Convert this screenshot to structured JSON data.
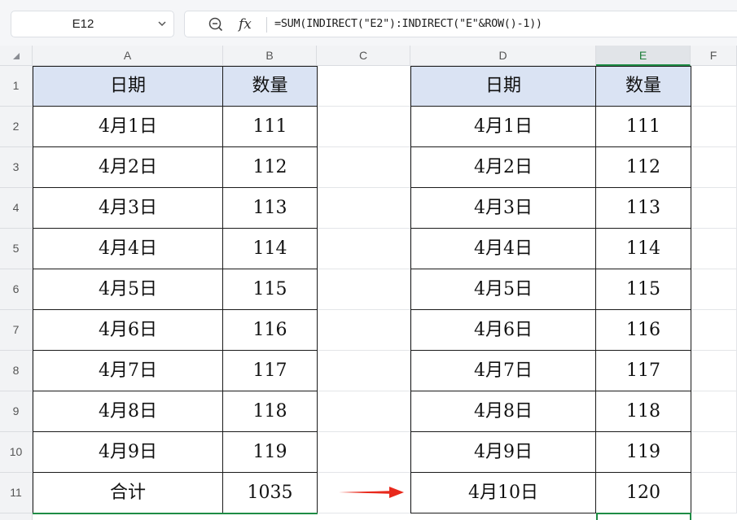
{
  "formula_bar": {
    "cell_ref": "E12",
    "formula": "=SUM(INDIRECT(\"E2\"):INDIRECT(\"E\"&ROW()-1))",
    "fx_label": "fx"
  },
  "columns": [
    "A",
    "B",
    "C",
    "D",
    "E",
    "F"
  ],
  "active_column": "E",
  "rows": [
    "1",
    "2",
    "3",
    "4",
    "5",
    "6",
    "7",
    "8",
    "9",
    "10",
    "11"
  ],
  "left_table": {
    "headers": [
      "日期",
      "数量"
    ],
    "rows": [
      [
        "4月1日",
        "111"
      ],
      [
        "4月2日",
        "112"
      ],
      [
        "4月3日",
        "113"
      ],
      [
        "4月4日",
        "114"
      ],
      [
        "4月5日",
        "115"
      ],
      [
        "4月6日",
        "116"
      ],
      [
        "4月7日",
        "117"
      ],
      [
        "4月8日",
        "118"
      ],
      [
        "4月9日",
        "119"
      ],
      [
        "合计",
        "1035"
      ]
    ]
  },
  "right_table": {
    "headers": [
      "日期",
      "数量"
    ],
    "rows": [
      [
        "4月1日",
        "111"
      ],
      [
        "4月2日",
        "112"
      ],
      [
        "4月3日",
        "113"
      ],
      [
        "4月4日",
        "114"
      ],
      [
        "4月5日",
        "115"
      ],
      [
        "4月6日",
        "116"
      ],
      [
        "4月7日",
        "117"
      ],
      [
        "4月8日",
        "118"
      ],
      [
        "4月9日",
        "119"
      ],
      [
        "4月10日",
        "120"
      ]
    ]
  },
  "colors": {
    "header_fill": "#dae3f3",
    "selection": "#1e8c45",
    "arrow": "#e8291c"
  }
}
